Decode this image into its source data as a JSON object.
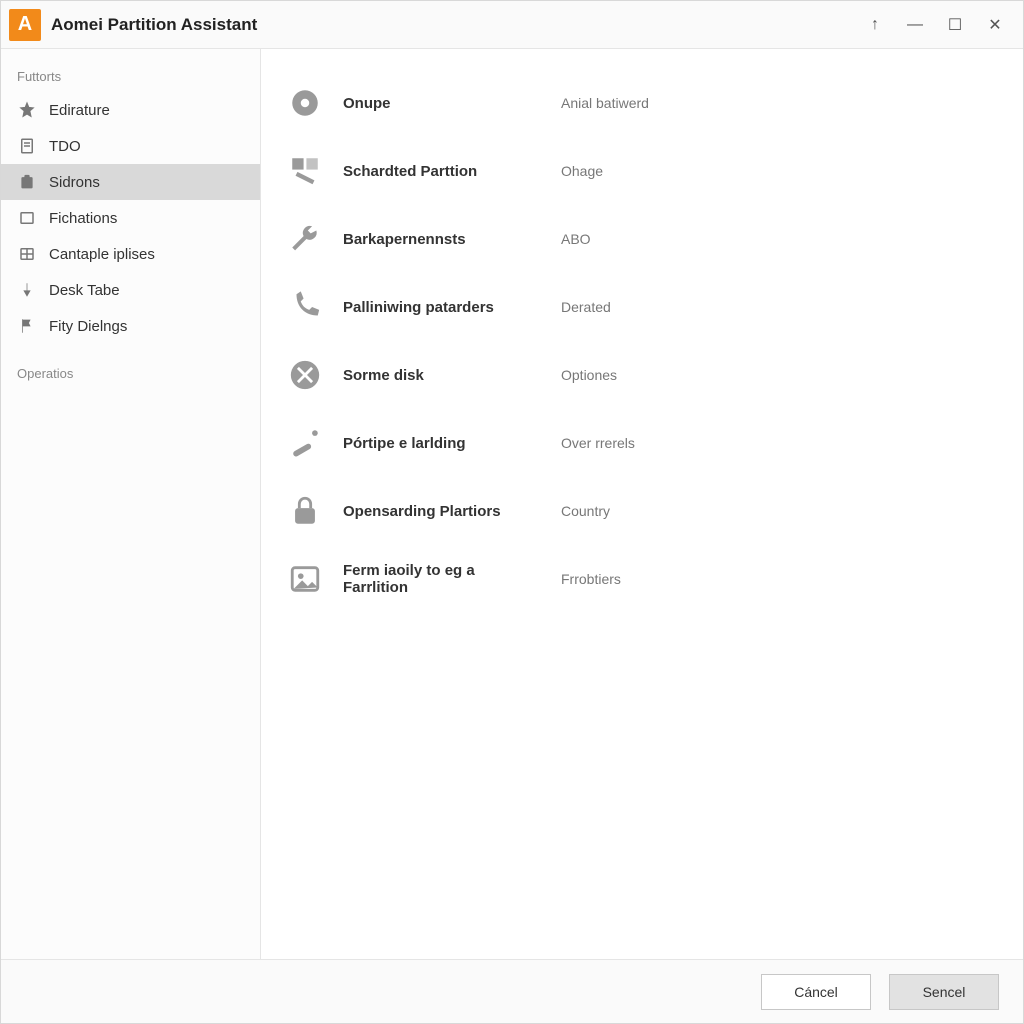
{
  "app": {
    "logo_letter": "A",
    "title": "Aomei Partition Assistant"
  },
  "window_controls": {
    "up": "↑",
    "minimize": "—",
    "maximize": "☐",
    "close": "✕"
  },
  "sidebar": {
    "section1_label": "Futtorts",
    "items": [
      {
        "icon": "star",
        "label": "Edirature"
      },
      {
        "icon": "doc",
        "label": "TDO"
      },
      {
        "icon": "box",
        "label": "Sidrons"
      },
      {
        "icon": "rect",
        "label": "Fichations"
      },
      {
        "icon": "grid",
        "label": "Cantaple iplises"
      },
      {
        "icon": "pin",
        "label": "Desk Tabe"
      },
      {
        "icon": "flag",
        "label": "Fity Dielngs"
      }
    ],
    "selected_index": 2,
    "section2_label": "Operatios"
  },
  "rows": [
    {
      "icon": "disc",
      "name": "Onupe",
      "value": "Anial batiwerd"
    },
    {
      "icon": "partition",
      "name": "Schardted Parttion",
      "value": "Ohage"
    },
    {
      "icon": "wrench",
      "name": "Barkapernennsts",
      "value": "ABO"
    },
    {
      "icon": "phone",
      "name": "Palliniwing patarders",
      "value": "Derated"
    },
    {
      "icon": "tools",
      "name": "Sorme disk",
      "value": "Optiones"
    },
    {
      "icon": "wand",
      "name": "Pórtipe e larlding",
      "value": "Over rrerels"
    },
    {
      "icon": "lock",
      "name": "Opensarding Plartiors",
      "value": "Country"
    },
    {
      "icon": "image",
      "name": "Ferm iaoily to eg a Farrlition",
      "value": "Frrobtiers"
    }
  ],
  "footer": {
    "cancel_label": "Cáncel",
    "sencel_label": "Sencel"
  }
}
